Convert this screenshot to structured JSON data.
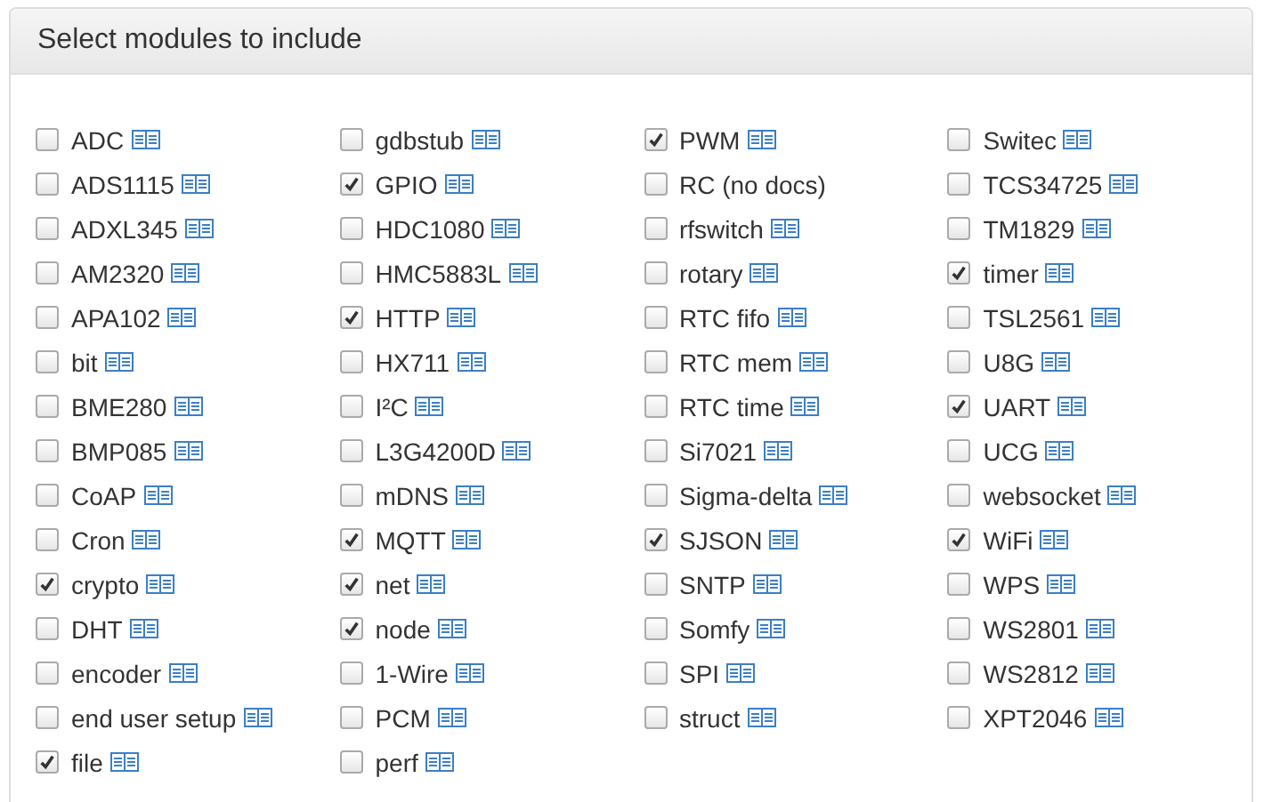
{
  "panel": {
    "title": "Select modules to include",
    "columns": [
      [
        {
          "label": "ADC",
          "checked": false,
          "docs": true
        },
        {
          "label": "ADS1115",
          "checked": false,
          "docs": true
        },
        {
          "label": "ADXL345",
          "checked": false,
          "docs": true
        },
        {
          "label": "AM2320",
          "checked": false,
          "docs": true
        },
        {
          "label": "APA102",
          "checked": false,
          "docs": true
        },
        {
          "label": "bit",
          "checked": false,
          "docs": true
        },
        {
          "label": "BME280",
          "checked": false,
          "docs": true
        },
        {
          "label": "BMP085",
          "checked": false,
          "docs": true
        },
        {
          "label": "CoAP",
          "checked": false,
          "docs": true
        },
        {
          "label": "Cron",
          "checked": false,
          "docs": true
        },
        {
          "label": "crypto",
          "checked": true,
          "docs": true
        },
        {
          "label": "DHT",
          "checked": false,
          "docs": true
        },
        {
          "label": "encoder",
          "checked": false,
          "docs": true
        },
        {
          "label": "end user setup",
          "checked": false,
          "docs": true
        },
        {
          "label": "file",
          "checked": true,
          "docs": true
        }
      ],
      [
        {
          "label": "gdbstub",
          "checked": false,
          "docs": true
        },
        {
          "label": "GPIO",
          "checked": true,
          "docs": true
        },
        {
          "label": "HDC1080",
          "checked": false,
          "docs": true
        },
        {
          "label": "HMC5883L",
          "checked": false,
          "docs": true
        },
        {
          "label": "HTTP",
          "checked": true,
          "docs": true
        },
        {
          "label": "HX711",
          "checked": false,
          "docs": true
        },
        {
          "label": "I²C",
          "checked": false,
          "docs": true
        },
        {
          "label": "L3G4200D",
          "checked": false,
          "docs": true
        },
        {
          "label": "mDNS",
          "checked": false,
          "docs": true
        },
        {
          "label": "MQTT",
          "checked": true,
          "docs": true
        },
        {
          "label": "net",
          "checked": true,
          "docs": true
        },
        {
          "label": "node",
          "checked": true,
          "docs": true
        },
        {
          "label": "1-Wire",
          "checked": false,
          "docs": true
        },
        {
          "label": "PCM",
          "checked": false,
          "docs": true
        },
        {
          "label": "perf",
          "checked": false,
          "docs": true
        }
      ],
      [
        {
          "label": "PWM",
          "checked": true,
          "docs": true
        },
        {
          "label": "RC (no docs)",
          "checked": false,
          "docs": false
        },
        {
          "label": "rfswitch",
          "checked": false,
          "docs": true
        },
        {
          "label": "rotary",
          "checked": false,
          "docs": true
        },
        {
          "label": "RTC fifo",
          "checked": false,
          "docs": true
        },
        {
          "label": "RTC mem",
          "checked": false,
          "docs": true
        },
        {
          "label": "RTC time",
          "checked": false,
          "docs": true
        },
        {
          "label": "Si7021",
          "checked": false,
          "docs": true
        },
        {
          "label": "Sigma-delta",
          "checked": false,
          "docs": true
        },
        {
          "label": "SJSON",
          "checked": true,
          "docs": true
        },
        {
          "label": "SNTP",
          "checked": false,
          "docs": true
        },
        {
          "label": "Somfy",
          "checked": false,
          "docs": true
        },
        {
          "label": "SPI",
          "checked": false,
          "docs": true
        },
        {
          "label": "struct",
          "checked": false,
          "docs": true
        }
      ],
      [
        {
          "label": "Switec",
          "checked": false,
          "docs": true
        },
        {
          "label": "TCS34725",
          "checked": false,
          "docs": true
        },
        {
          "label": "TM1829",
          "checked": false,
          "docs": true
        },
        {
          "label": "timer",
          "checked": true,
          "docs": true
        },
        {
          "label": "TSL2561",
          "checked": false,
          "docs": true
        },
        {
          "label": "U8G",
          "checked": false,
          "docs": true
        },
        {
          "label": "UART",
          "checked": true,
          "docs": true
        },
        {
          "label": "UCG",
          "checked": false,
          "docs": true
        },
        {
          "label": "websocket",
          "checked": false,
          "docs": true
        },
        {
          "label": "WiFi",
          "checked": true,
          "docs": true
        },
        {
          "label": "WPS",
          "checked": false,
          "docs": true
        },
        {
          "label": "WS2801",
          "checked": false,
          "docs": true
        },
        {
          "label": "WS2812",
          "checked": false,
          "docs": true
        },
        {
          "label": "XPT2046",
          "checked": false,
          "docs": true
        }
      ]
    ]
  }
}
